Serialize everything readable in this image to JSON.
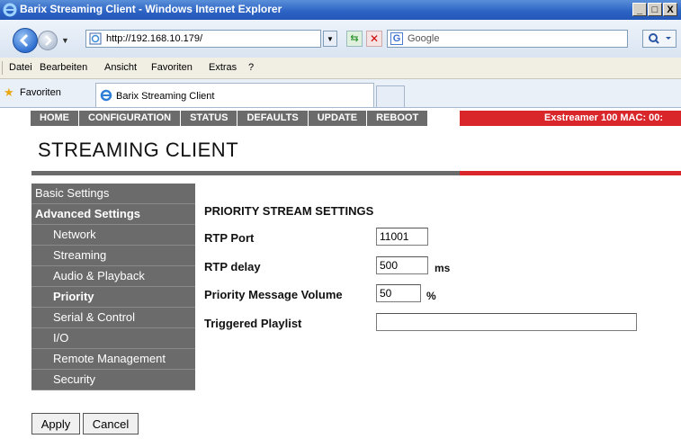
{
  "window": {
    "title": "Barix Streaming Client - Windows Internet Explorer",
    "controls": [
      "_",
      "□",
      "X"
    ]
  },
  "addressbar": {
    "url": "http://192.168.10.179/",
    "search_placeholder": "Google"
  },
  "menubar": {
    "items": [
      "Datei",
      "Bearbeiten",
      "Ansicht",
      "Favoriten",
      "Extras",
      "?"
    ]
  },
  "favorites": {
    "label": "Favoriten",
    "tab_label": "Barix Streaming Client"
  },
  "page": {
    "topnav": [
      "HOME",
      "CONFIGURATION",
      "STATUS",
      "DEFAULTS",
      "UPDATE",
      "REBOOT"
    ],
    "device_info": "Exstreamer 100  MAC: 00:",
    "title": "STREAMING CLIENT",
    "sidebar": [
      {
        "label": "Basic Settings",
        "level": 0,
        "bold": false
      },
      {
        "label": "Advanced Settings",
        "level": 0,
        "bold": true
      },
      {
        "label": "Network",
        "level": 1,
        "bold": false
      },
      {
        "label": "Streaming",
        "level": 1,
        "bold": false
      },
      {
        "label": "Audio & Playback",
        "level": 1,
        "bold": false
      },
      {
        "label": "Priority",
        "level": 1,
        "bold": true
      },
      {
        "label": "Serial & Control",
        "level": 1,
        "bold": false
      },
      {
        "label": "I/O",
        "level": 1,
        "bold": false
      },
      {
        "label": "Remote Management",
        "level": 1,
        "bold": false
      },
      {
        "label": "Security",
        "level": 1,
        "bold": false
      }
    ],
    "form": {
      "heading": "PRIORITY STREAM SETTINGS",
      "rtp_port_label": "RTP Port",
      "rtp_port_value": "11001",
      "rtp_delay_label": "RTP delay",
      "rtp_delay_value": "500",
      "rtp_delay_unit": "ms",
      "volume_label": "Priority Message Volume",
      "volume_value": "50",
      "volume_unit": "%",
      "playlist_label": "Triggered Playlist",
      "playlist_value": ""
    },
    "buttons": {
      "apply": "Apply",
      "cancel": "Cancel"
    }
  },
  "colors": {
    "nav_grey": "#6b6b6b",
    "accent_red": "#d8262b",
    "ie_blue": "#2b62c4"
  }
}
